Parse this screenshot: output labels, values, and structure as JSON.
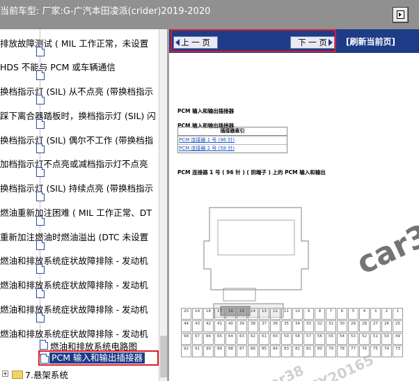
{
  "title_bar": {
    "title": "当前车型:   厂家:G-广汽本田凌派(crider)2019-2020"
  },
  "tree": {
    "items": [
      {
        "label": "排放故障测试 ( MIL 工作正常，未设置"
      },
      {
        "label": "HDS 不能与 PCM 或车辆通信"
      },
      {
        "label": "换档指示灯 (SIL) 从不点亮 (带换档指示"
      },
      {
        "label": "踩下离合器踏板时，换档指示灯 (SIL) 闪"
      },
      {
        "label": "换档指示灯 (SIL) 偶尔不工作 (带换档指"
      },
      {
        "label": "加档指示灯不点亮或减档指示灯不点亮"
      },
      {
        "label": "换档指示灯 (SIL) 持续点亮 (带换档指示"
      },
      {
        "label": "燃油重新加注困难 ( MIL 工作正常、DT"
      },
      {
        "label": "重新加注燃油时燃油溢出 (DTC 未设置"
      },
      {
        "label": "燃油和排放系统症状故障排除 - 发动机"
      },
      {
        "label": "燃油和排放系统症状故障排除 - 发动机"
      },
      {
        "label": "燃油和排放系统症状故障排除 - 发动机"
      },
      {
        "label": "燃油和排放系统症状故障排除 - 发动机"
      }
    ],
    "sub_item": "燃油和排放系统电路图",
    "selected_item": "PCM 输入和输出插接器",
    "folder_item": "7.悬架系统",
    "expander": "+"
  },
  "nav": {
    "prev_label": "上 一 页",
    "next_label": "下 一 页",
    "refresh_label": "[刷新当前页]"
  },
  "content": {
    "heading1": "PCM 输入和输出插接器",
    "heading2": "PCM 输入和输出插接器",
    "index_header": "插接器索引",
    "index_links": [
      "PCM 连接器 1 号 (96 针)",
      "PCM 连接器 2 号 (58 针)"
    ],
    "section_title": "PCM 连接器 1 号 ( 96 针 ) ( 阴端子 ) 上的 PCM 输入和输出",
    "pin_rows": [
      [
        "20",
        "19",
        "18",
        "17",
        "16",
        "15",
        "14",
        "13",
        "12",
        "11",
        "10",
        "9",
        "8",
        "7",
        "6",
        "5",
        "4",
        "3",
        "2",
        "1"
      ],
      [
        "44",
        "43",
        "42",
        "41",
        "40",
        "39",
        "38",
        "37",
        "36",
        "35",
        "34",
        "33",
        "32",
        "31",
        "30",
        "29",
        "28",
        "27",
        "26",
        "25"
      ],
      [
        "68",
        "67",
        "66",
        "65",
        "64",
        "63",
        "62",
        "61",
        "60",
        "59",
        "58",
        "57",
        "56",
        "55",
        "54",
        "53",
        "52",
        "51",
        "50",
        "49"
      ],
      [
        "92",
        "91",
        "90",
        "89",
        "88",
        "87",
        "86",
        "85",
        "84",
        "83",
        "82",
        "81",
        "80",
        "79",
        "78",
        "77",
        "76",
        "75",
        "74",
        "73"
      ]
    ],
    "watermark_main": "car38",
    "watermark_2": "car38",
    "watermark_3": "CY20165"
  },
  "colors": {
    "accent_blue": "#1f3c88",
    "highlight_red": "#e01b24",
    "title_gray": "#909090"
  }
}
